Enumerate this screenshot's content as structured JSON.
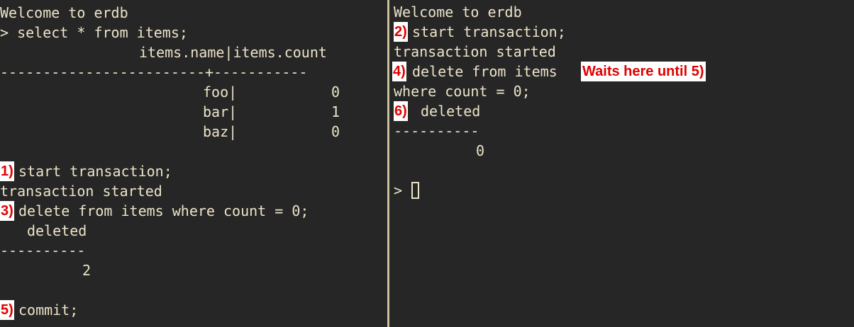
{
  "left_pane": {
    "welcome": "Welcome to erdb",
    "query": "> select * from items;",
    "header": "items.name|items.count",
    "separator": "------------------------+-----------",
    "rows": [
      {
        "name": "foo|",
        "count": "0"
      },
      {
        "name": "bar|",
        "count": "1"
      },
      {
        "name": "baz|",
        "count": "0"
      }
    ],
    "step1_badge": "1)",
    "step1_cmd": "start transaction;",
    "step1_result": "transaction started",
    "step3_badge": "3)",
    "step3_cmd": "delete from items where count = 0;",
    "step3_result_header": "deleted",
    "step3_result_sep": "----------",
    "step3_result_value": "2",
    "step5_badge": "5)",
    "step5_cmd": "commit;"
  },
  "right_pane": {
    "welcome": "Welcome to erdb",
    "step2_badge": "2)",
    "step2_cmd": "start transaction;",
    "step2_result": "transaction started",
    "step4_badge": "4)",
    "step4_cmd_line1": "delete from items",
    "step4_note": "Waits here until 5)",
    "step4_cmd_line2": "where count = 0;",
    "step6_badge": "6)",
    "step6_result_header": "deleted",
    "step6_result_sep": "----------",
    "step6_result_value": "0",
    "prompt": ">"
  },
  "colors": {
    "background": "#262626",
    "text": "#ece3c8",
    "annotation": "#e00000",
    "divider": "#c9bf99"
  }
}
